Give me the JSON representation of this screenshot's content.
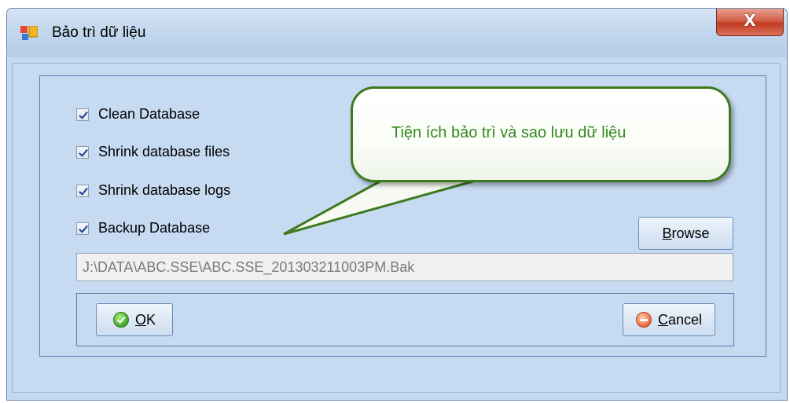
{
  "window": {
    "title": "Bảo trì dữ liệu",
    "close_label": "X"
  },
  "options": [
    {
      "label": "Clean Database",
      "checked": true
    },
    {
      "label": "Shrink database files",
      "checked": true
    },
    {
      "label": "Shrink database logs",
      "checked": true
    },
    {
      "label": "Backup Database",
      "checked": true
    }
  ],
  "callout": {
    "text": "Tiện ích bảo trì và sao lưu dữ liệu",
    "border_color": "#3d7a1f",
    "text_color": "#2f8a1c"
  },
  "browse": {
    "accel": "B",
    "rest": "rowse"
  },
  "backup_path": {
    "value": "J:\\DATA\\ABC.SSE\\ABC.SSE_201303211003PM.Bak"
  },
  "buttons": {
    "ok": {
      "accel": "O",
      "rest": "K",
      "icon": "check-circle-icon"
    },
    "cancel": {
      "accel": "C",
      "rest": "ancel",
      "icon": "minus-circle-icon"
    }
  }
}
